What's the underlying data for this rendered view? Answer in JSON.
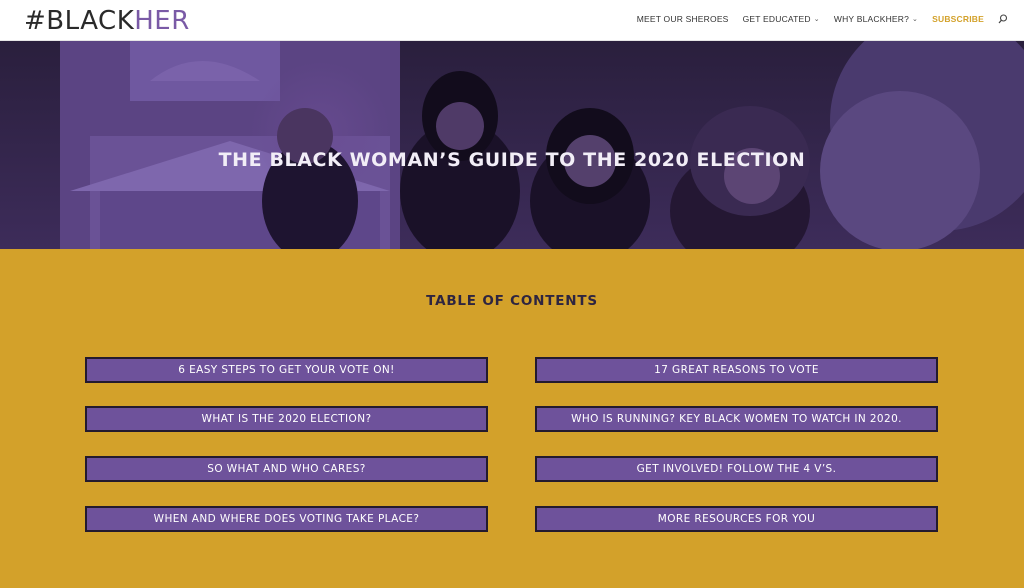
{
  "header": {
    "logo_prefix": "#BLACK",
    "logo_accent": "HER",
    "nav": [
      {
        "label": "MEET OUR SHEROES",
        "has_dropdown": false
      },
      {
        "label": "GET EDUCATED",
        "has_dropdown": true
      },
      {
        "label": "WHY BLACKHER?",
        "has_dropdown": true
      },
      {
        "label": "SUBSCRIBE",
        "has_dropdown": false
      }
    ],
    "search_icon": "search-icon"
  },
  "hero": {
    "title": "THE BLACK WOMAN’S GUIDE TO THE 2020 ELECTION"
  },
  "toc": {
    "title": "TABLE OF CONTENTS",
    "items": [
      "6 EASY STEPS TO GET YOUR VOTE ON!",
      "17 GREAT REASONS TO VOTE",
      "WHAT IS THE 2020 ELECTION?",
      "WHO IS RUNNING? KEY BLACK WOMEN TO WATCH IN 2020.",
      "SO WHAT AND WHO CARES?",
      "GET INVOLVED! FOLLOW THE 4 V’S.",
      "WHEN AND WHERE DOES VOTING TAKE PLACE?",
      "MORE RESOURCES FOR YOU"
    ]
  },
  "colors": {
    "gold": "#d3a12a",
    "purple": "#6e529b",
    "logo_accent": "#7a5aa6",
    "dark": "#2a1a40"
  }
}
